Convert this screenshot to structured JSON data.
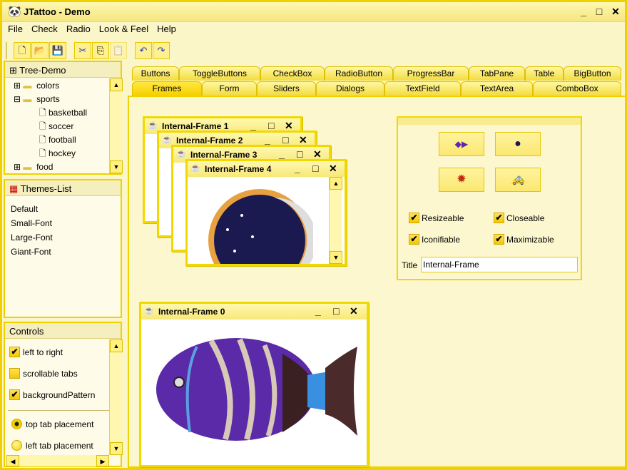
{
  "window": {
    "title": "JTattoo - Demo",
    "minimize": "_",
    "maximize": "□",
    "close": "✕"
  },
  "menu": [
    "File",
    "Check",
    "Radio",
    "Look & Feel",
    "Help"
  ],
  "toolbar": [
    "new-icon",
    "open-icon",
    "save-icon",
    "cut-icon",
    "copy-icon",
    "paste-icon",
    "undo-icon",
    "redo-icon"
  ],
  "tree": {
    "title": "Tree-Demo",
    "items": [
      {
        "label": "colors",
        "type": "folder",
        "expanded": false
      },
      {
        "label": "sports",
        "type": "folder",
        "expanded": true
      },
      {
        "label": "basketball",
        "type": "leaf"
      },
      {
        "label": "soccer",
        "type": "leaf"
      },
      {
        "label": "football",
        "type": "leaf"
      },
      {
        "label": "hockey",
        "type": "leaf"
      },
      {
        "label": "food",
        "type": "folder",
        "expanded": false
      }
    ]
  },
  "themes": {
    "title": "Themes-List",
    "items": [
      "Default",
      "Small-Font",
      "Large-Font",
      "Giant-Font"
    ]
  },
  "controls": {
    "title": "Controls",
    "checks": [
      {
        "label": "left to right",
        "checked": true
      },
      {
        "label": "scrollable tabs",
        "checked": false
      },
      {
        "label": "backgroundPattern",
        "checked": true
      }
    ],
    "radios": [
      {
        "label": "top tab placement",
        "selected": true
      },
      {
        "label": "left tab placement",
        "selected": false
      }
    ]
  },
  "tabs": {
    "row1": [
      "Buttons",
      "ToggleButtons",
      "CheckBox",
      "RadioButton",
      "ProgressBar",
      "TabPane",
      "Table",
      "BigButton"
    ],
    "row2": [
      "Frames",
      "Form",
      "Sliders",
      "Dialogs",
      "TextField",
      "TextArea",
      "ComboBox"
    ],
    "selected": "Frames"
  },
  "frames": [
    "Internal-Frame 1",
    "Internal-Frame 2",
    "Internal-Frame 3",
    "Internal-Frame 4",
    "Internal-Frame 0"
  ],
  "options": {
    "resizeable": "Resizeable",
    "closeable": "Closeable",
    "iconifiable": "Iconifiable",
    "maximizable": "Maximizable",
    "title_label": "Title",
    "title_value": "Internal-Frame",
    "check_mark": "✔"
  }
}
